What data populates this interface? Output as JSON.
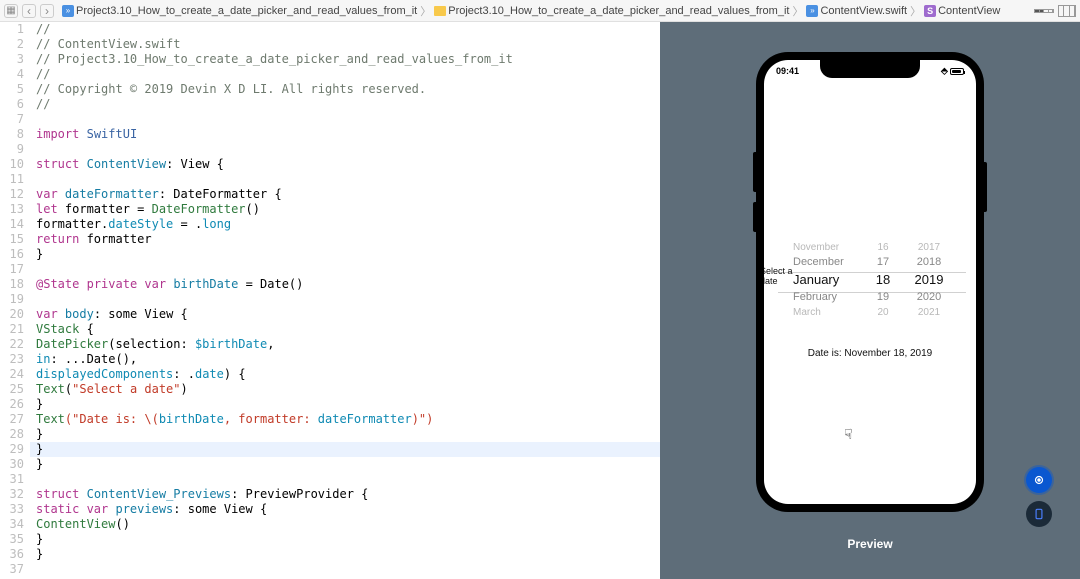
{
  "toolbar": {
    "crumb1": "Project3.10_How_to_create_a_date_picker_and_read_values_from_it",
    "crumb2": "Project3.10_How_to_create_a_date_picker_and_read_values_from_it",
    "crumb3": "ContentView.swift",
    "crumb4": "ContentView"
  },
  "code": {
    "lines": [
      {
        "n": 1,
        "t": "comment",
        "s": "  //"
      },
      {
        "n": 2,
        "t": "comment",
        "s": "  //  ContentView.swift"
      },
      {
        "n": 3,
        "t": "comment",
        "s": "  //  Project3.10_How_to_create_a_date_picker_and_read_values_from_it"
      },
      {
        "n": 4,
        "t": "comment",
        "s": "  //"
      },
      {
        "n": 5,
        "t": "comment",
        "s": "  //  Copyright © 2019 Devin X D LI. All rights reserved."
      },
      {
        "n": 6,
        "t": "comment",
        "s": "  //"
      },
      {
        "n": 7,
        "t": "plain",
        "s": ""
      },
      {
        "n": 8,
        "t": "imp",
        "tokens": [
          "import",
          " ",
          "SwiftUI"
        ]
      },
      {
        "n": 9,
        "t": "plain",
        "s": ""
      },
      {
        "n": 10,
        "t": "struct1",
        "head": "struct",
        "name": "ContentView",
        "tail": ": View {"
      },
      {
        "n": 11,
        "t": "plain",
        "s": ""
      },
      {
        "n": 12,
        "t": "vardecl",
        "indent": 6,
        "kw": "var",
        "name": "dateFormatter",
        "type": ": DateFormatter {"
      },
      {
        "n": 13,
        "t": "letdecl",
        "indent": 10,
        "kw": "let",
        "name": "formatter = ",
        "call": "DateFormatter",
        "suffix": "()"
      },
      {
        "n": 14,
        "t": "assign",
        "indent": 10,
        "lhs": "formatter.",
        "prop": "dateStyle",
        "rhs": " = .",
        "val": "long"
      },
      {
        "n": 15,
        "t": "ret",
        "indent": 10,
        "kw": "return",
        "rest": " formatter"
      },
      {
        "n": 16,
        "t": "plain",
        "s": "      }"
      },
      {
        "n": 17,
        "t": "plain",
        "s": ""
      },
      {
        "n": 18,
        "t": "state",
        "indent": 6,
        "at": "@State",
        "kw": "private var",
        "name": "birthDate",
        "rest": " = Date()"
      },
      {
        "n": 19,
        "t": "plain",
        "s": ""
      },
      {
        "n": 20,
        "t": "body",
        "indent": 6,
        "kw": "var",
        "name": "body",
        "type": ": some View {"
      },
      {
        "n": 21,
        "t": "call",
        "indent": 10,
        "name": "VStack",
        "rest": " {"
      },
      {
        "n": 22,
        "t": "dp",
        "indent": 14,
        "name": "DatePicker",
        "rest": "(selection: ",
        "id": "$birthDate",
        "tail": ","
      },
      {
        "n": 23,
        "t": "dp2",
        "indent": 33,
        "lbl": "in",
        "rest": ": ...Date(),"
      },
      {
        "n": 24,
        "t": "dp3",
        "indent": 33,
        "lbl": "displayedComponents",
        "rest": ": .",
        "val": "date",
        "tail": ") {"
      },
      {
        "n": 25,
        "t": "text",
        "indent": 18,
        "name": "Text",
        "str": "\"Select a date\"",
        "tail": ")"
      },
      {
        "n": 26,
        "t": "plain",
        "s": "              }"
      },
      {
        "n": 27,
        "t": "text2",
        "indent": 14,
        "name": "Text",
        "p1": "(\"Date is: \\(",
        "id": "birthDate",
        "p2": ", formatter: ",
        "id2": "dateFormatter",
        "p3": ")\")"
      },
      {
        "n": 28,
        "t": "plain",
        "s": "          }"
      },
      {
        "n": 29,
        "t": "plain_hl",
        "s": "      }"
      },
      {
        "n": 30,
        "t": "plain",
        "s": "  }"
      },
      {
        "n": 31,
        "t": "plain",
        "s": ""
      },
      {
        "n": 32,
        "t": "struct1",
        "head": "struct",
        "name": "ContentView_Previews",
        "tail": ": PreviewProvider {"
      },
      {
        "n": 33,
        "t": "body",
        "indent": 6,
        "kw": "static var",
        "name": "previews",
        "type": ": some View {"
      },
      {
        "n": 34,
        "t": "call",
        "indent": 10,
        "name": "ContentView",
        "rest": "()"
      },
      {
        "n": 35,
        "t": "plain",
        "s": "      }"
      },
      {
        "n": 36,
        "t": "plain",
        "s": "  }"
      },
      {
        "n": 37,
        "t": "plain",
        "s": ""
      }
    ]
  },
  "preview": {
    "status_time": "09:41",
    "select_label": "Select a date",
    "months": [
      "November",
      "December",
      "January",
      "February",
      "March"
    ],
    "days": [
      "16",
      "17",
      "18",
      "19",
      "20"
    ],
    "years": [
      "2017",
      "2018",
      "2019",
      "2020",
      "2021"
    ],
    "date_output": "Date is: November 18, 2019",
    "label": "Preview"
  }
}
